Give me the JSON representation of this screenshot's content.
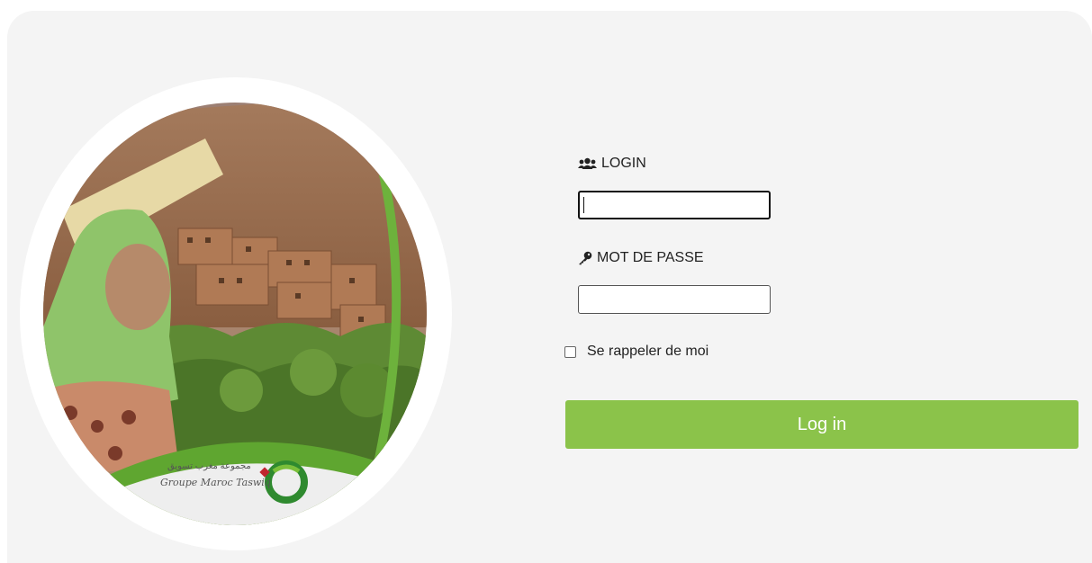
{
  "brand": {
    "logo_latin": "Groupe Maroc Taswiq",
    "logo_arabic": "مجموعة مغرب تسويق",
    "accent_color": "#8bc34a"
  },
  "login": {
    "label": "LOGIN",
    "icon": "users-icon",
    "value": ""
  },
  "password": {
    "label": "MOT DE PASSE",
    "icon": "key-icon",
    "value": ""
  },
  "remember": {
    "label": "Se rappeler de moi",
    "checked": false
  },
  "submit": {
    "label": "Log in"
  }
}
